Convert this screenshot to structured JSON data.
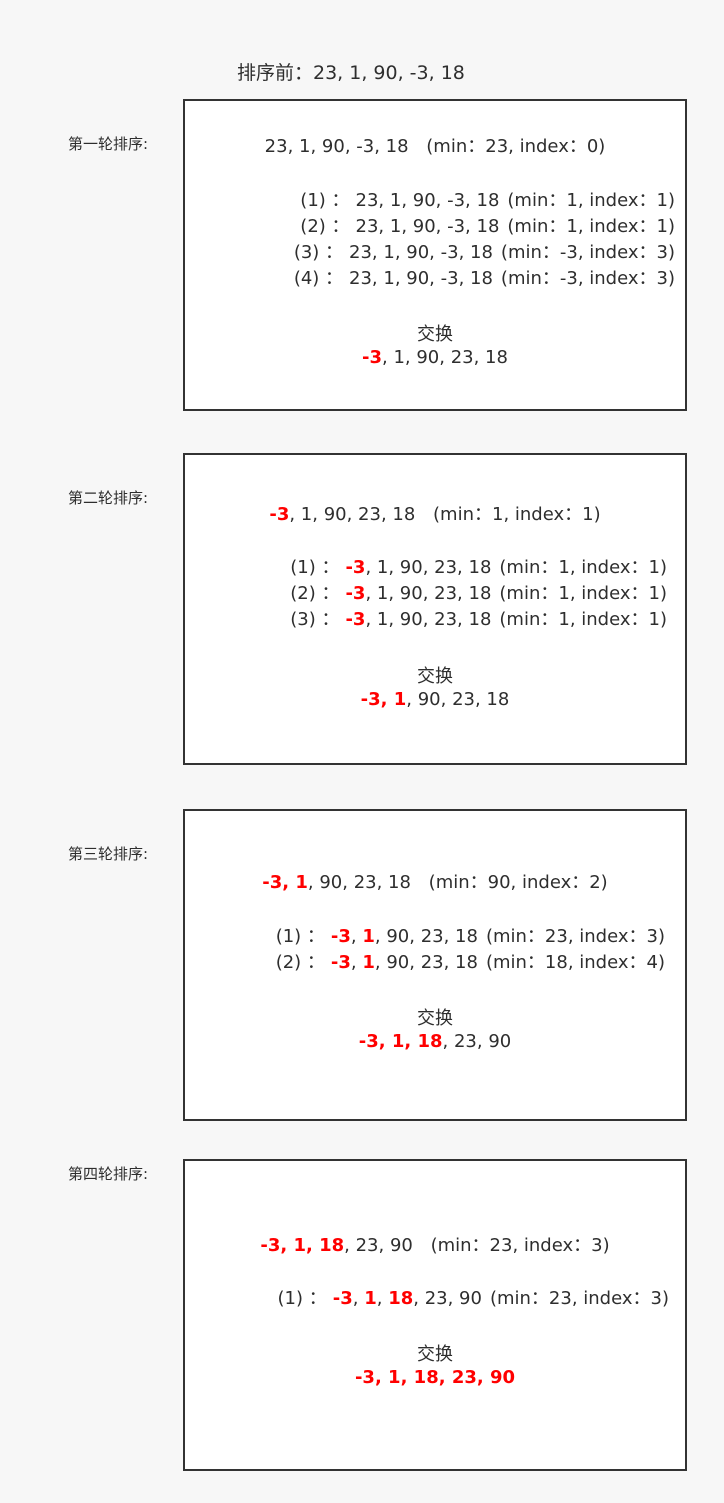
{
  "title": "排序前：23, 1, 90, -3, 18",
  "swap_word": "交换",
  "rounds": [
    {
      "label": "第一轮排序:",
      "initial": {
        "seq": [
          [
            "23, 1, 90, -3, 18",
            false
          ]
        ],
        "info": "(min：23, index：0)"
      },
      "steps": [
        {
          "prefix": "(1) ：",
          "seq": [
            [
              "23, 1, 90, -3, 18",
              false
            ]
          ],
          "info": "(min：1, index：1)"
        },
        {
          "prefix": "(2) ：",
          "seq": [
            [
              "23, 1, 90, -3, 18",
              false
            ]
          ],
          "info": "(min：1, index：1)"
        },
        {
          "prefix": "(3) ：",
          "seq": [
            [
              "23, 1, 90, -3, 18",
              false
            ]
          ],
          "info": "(min：-3, index：3)"
        },
        {
          "prefix": "(4) ：",
          "seq": [
            [
              "23, 1, 90, -3, 18",
              false
            ]
          ],
          "info": "(min：-3, index：3)"
        }
      ],
      "result": [
        [
          "-3",
          true
        ],
        [
          ", 1, 90, 23, 18",
          false
        ]
      ]
    },
    {
      "label": "第二轮排序:",
      "initial": {
        "seq": [
          [
            "-3",
            true
          ],
          [
            ", 1, 90, 23, 18",
            false
          ]
        ],
        "info": "(min：1, index：1)"
      },
      "steps": [
        {
          "prefix": "(1) ：",
          "seq": [
            [
              "-3",
              true
            ],
            [
              ", 1, 90, 23, 18",
              false
            ]
          ],
          "info": "(min：1, index：1)"
        },
        {
          "prefix": "(2) ：",
          "seq": [
            [
              "-3",
              true
            ],
            [
              ", 1, 90, 23, 18",
              false
            ]
          ],
          "info": "(min：1, index：1)"
        },
        {
          "prefix": "(3) ：",
          "seq": [
            [
              "-3",
              true
            ],
            [
              ", 1, 90, 23, 18",
              false
            ]
          ],
          "info": "(min：1, index：1)"
        }
      ],
      "result": [
        [
          "-3, 1",
          true
        ],
        [
          ", 90, 23, 18",
          false
        ]
      ]
    },
    {
      "label": "第三轮排序:",
      "initial": {
        "seq": [
          [
            "-3, 1",
            true
          ],
          [
            ", 90, 23, 18",
            false
          ]
        ],
        "info": "(min：90, index：2)"
      },
      "steps": [
        {
          "prefix": "(1) ：",
          "seq": [
            [
              "-3",
              true
            ],
            [
              ", ",
              false
            ],
            [
              "1",
              true
            ],
            [
              ", 90, 23, 18",
              false
            ]
          ],
          "info": "(min：23, index：3)"
        },
        {
          "prefix": "(2) ：",
          "seq": [
            [
              "-3",
              true
            ],
            [
              ", ",
              false
            ],
            [
              "1",
              true
            ],
            [
              ", 90, 23, 18",
              false
            ]
          ],
          "info": "(min：18, index：4)"
        }
      ],
      "result": [
        [
          "-3, 1, 18",
          true
        ],
        [
          ", 23, 90",
          false
        ]
      ]
    },
    {
      "label": "第四轮排序:",
      "initial": {
        "seq": [
          [
            "-3, 1, 18",
            true
          ],
          [
            ", 23, 90",
            false
          ]
        ],
        "info": "(min：23, index：3)"
      },
      "steps": [
        {
          "prefix": "(1) ：",
          "seq": [
            [
              "-3",
              true
            ],
            [
              ", ",
              false
            ],
            [
              "1",
              true
            ],
            [
              ", ",
              false
            ],
            [
              "18",
              true
            ],
            [
              ", 23, 90",
              false
            ]
          ],
          "info": "(min：23, index：3)"
        }
      ],
      "result": [
        [
          "-3, 1, 18, 23, 90",
          true
        ]
      ]
    }
  ]
}
